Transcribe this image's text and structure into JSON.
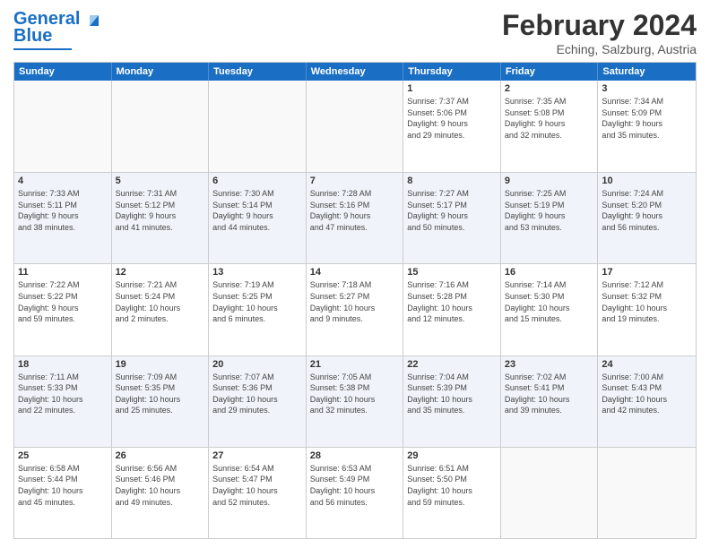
{
  "header": {
    "logo_main": "General",
    "logo_sub": "Blue",
    "month_title": "February 2024",
    "location": "Eching, Salzburg, Austria"
  },
  "days_of_week": [
    "Sunday",
    "Monday",
    "Tuesday",
    "Wednesday",
    "Thursday",
    "Friday",
    "Saturday"
  ],
  "weeks": [
    [
      {
        "day": "",
        "info": ""
      },
      {
        "day": "",
        "info": ""
      },
      {
        "day": "",
        "info": ""
      },
      {
        "day": "",
        "info": ""
      },
      {
        "day": "1",
        "info": "Sunrise: 7:37 AM\nSunset: 5:06 PM\nDaylight: 9 hours\nand 29 minutes."
      },
      {
        "day": "2",
        "info": "Sunrise: 7:35 AM\nSunset: 5:08 PM\nDaylight: 9 hours\nand 32 minutes."
      },
      {
        "day": "3",
        "info": "Sunrise: 7:34 AM\nSunset: 5:09 PM\nDaylight: 9 hours\nand 35 minutes."
      }
    ],
    [
      {
        "day": "4",
        "info": "Sunrise: 7:33 AM\nSunset: 5:11 PM\nDaylight: 9 hours\nand 38 minutes."
      },
      {
        "day": "5",
        "info": "Sunrise: 7:31 AM\nSunset: 5:12 PM\nDaylight: 9 hours\nand 41 minutes."
      },
      {
        "day": "6",
        "info": "Sunrise: 7:30 AM\nSunset: 5:14 PM\nDaylight: 9 hours\nand 44 minutes."
      },
      {
        "day": "7",
        "info": "Sunrise: 7:28 AM\nSunset: 5:16 PM\nDaylight: 9 hours\nand 47 minutes."
      },
      {
        "day": "8",
        "info": "Sunrise: 7:27 AM\nSunset: 5:17 PM\nDaylight: 9 hours\nand 50 minutes."
      },
      {
        "day": "9",
        "info": "Sunrise: 7:25 AM\nSunset: 5:19 PM\nDaylight: 9 hours\nand 53 minutes."
      },
      {
        "day": "10",
        "info": "Sunrise: 7:24 AM\nSunset: 5:20 PM\nDaylight: 9 hours\nand 56 minutes."
      }
    ],
    [
      {
        "day": "11",
        "info": "Sunrise: 7:22 AM\nSunset: 5:22 PM\nDaylight: 9 hours\nand 59 minutes."
      },
      {
        "day": "12",
        "info": "Sunrise: 7:21 AM\nSunset: 5:24 PM\nDaylight: 10 hours\nand 2 minutes."
      },
      {
        "day": "13",
        "info": "Sunrise: 7:19 AM\nSunset: 5:25 PM\nDaylight: 10 hours\nand 6 minutes."
      },
      {
        "day": "14",
        "info": "Sunrise: 7:18 AM\nSunset: 5:27 PM\nDaylight: 10 hours\nand 9 minutes."
      },
      {
        "day": "15",
        "info": "Sunrise: 7:16 AM\nSunset: 5:28 PM\nDaylight: 10 hours\nand 12 minutes."
      },
      {
        "day": "16",
        "info": "Sunrise: 7:14 AM\nSunset: 5:30 PM\nDaylight: 10 hours\nand 15 minutes."
      },
      {
        "day": "17",
        "info": "Sunrise: 7:12 AM\nSunset: 5:32 PM\nDaylight: 10 hours\nand 19 minutes."
      }
    ],
    [
      {
        "day": "18",
        "info": "Sunrise: 7:11 AM\nSunset: 5:33 PM\nDaylight: 10 hours\nand 22 minutes."
      },
      {
        "day": "19",
        "info": "Sunrise: 7:09 AM\nSunset: 5:35 PM\nDaylight: 10 hours\nand 25 minutes."
      },
      {
        "day": "20",
        "info": "Sunrise: 7:07 AM\nSunset: 5:36 PM\nDaylight: 10 hours\nand 29 minutes."
      },
      {
        "day": "21",
        "info": "Sunrise: 7:05 AM\nSunset: 5:38 PM\nDaylight: 10 hours\nand 32 minutes."
      },
      {
        "day": "22",
        "info": "Sunrise: 7:04 AM\nSunset: 5:39 PM\nDaylight: 10 hours\nand 35 minutes."
      },
      {
        "day": "23",
        "info": "Sunrise: 7:02 AM\nSunset: 5:41 PM\nDaylight: 10 hours\nand 39 minutes."
      },
      {
        "day": "24",
        "info": "Sunrise: 7:00 AM\nSunset: 5:43 PM\nDaylight: 10 hours\nand 42 minutes."
      }
    ],
    [
      {
        "day": "25",
        "info": "Sunrise: 6:58 AM\nSunset: 5:44 PM\nDaylight: 10 hours\nand 45 minutes."
      },
      {
        "day": "26",
        "info": "Sunrise: 6:56 AM\nSunset: 5:46 PM\nDaylight: 10 hours\nand 49 minutes."
      },
      {
        "day": "27",
        "info": "Sunrise: 6:54 AM\nSunset: 5:47 PM\nDaylight: 10 hours\nand 52 minutes."
      },
      {
        "day": "28",
        "info": "Sunrise: 6:53 AM\nSunset: 5:49 PM\nDaylight: 10 hours\nand 56 minutes."
      },
      {
        "day": "29",
        "info": "Sunrise: 6:51 AM\nSunset: 5:50 PM\nDaylight: 10 hours\nand 59 minutes."
      },
      {
        "day": "",
        "info": ""
      },
      {
        "day": "",
        "info": ""
      }
    ]
  ]
}
